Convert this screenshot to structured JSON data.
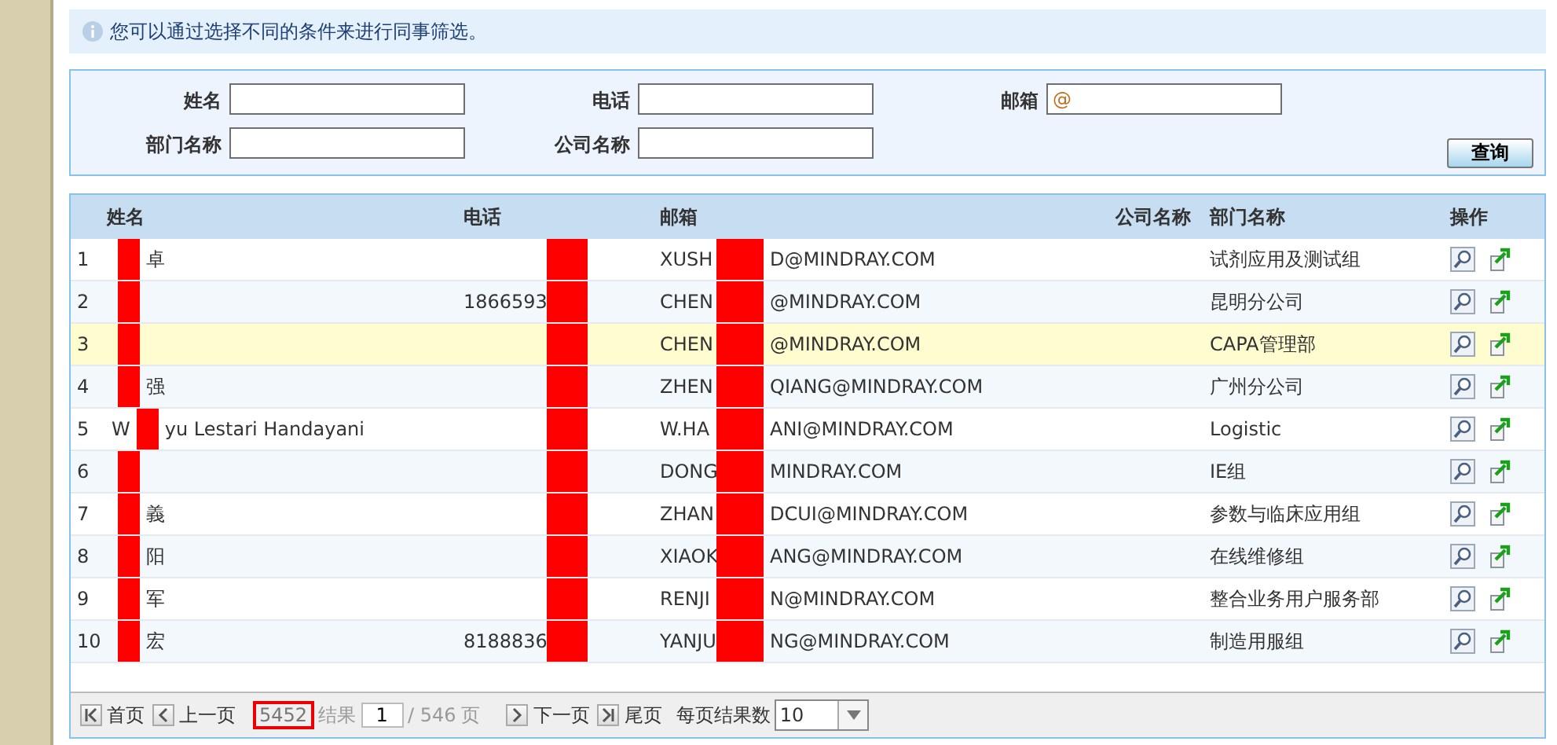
{
  "info": "您可以通过选择不同的条件来进行同事筛选。",
  "filters": [
    {
      "label": "姓名"
    },
    {
      "label": "电话"
    },
    {
      "label": "邮箱",
      "value": "@"
    },
    {
      "label": "部门名称"
    },
    {
      "label": "公司名称"
    }
  ],
  "search_button": "查询",
  "table": {
    "columns": [
      "姓名",
      "电话",
      "邮箱",
      "公司名称",
      "部门名称",
      "操作"
    ],
    "rows": [
      {
        "index": "1",
        "name_end": "卓",
        "email_start": "XUSH",
        "email_end": "D@MINDRAY.COM",
        "department": "试剂应用及测试组",
        "selected": false
      },
      {
        "index": "2",
        "phone_start": "1866593",
        "email_start": "CHEN",
        "email_end": "@MINDRAY.COM",
        "department": "昆明分公司",
        "selected": false
      },
      {
        "index": "3",
        "email_start": "CHEN",
        "email_end": "@MINDRAY.COM",
        "department": "CAPA管理部",
        "selected": true
      },
      {
        "index": "4",
        "name_end": "强",
        "email_start": "ZHEN",
        "email_end": "QIANG@MINDRAY.COM",
        "department": "广州分公司",
        "selected": false
      },
      {
        "index": "5",
        "name_start": "W",
        "name_end": "yu Lestari Handayani",
        "email_start": "W.HA",
        "email_end": "ANI@MINDRAY.COM",
        "department": "Logistic",
        "selected": false
      },
      {
        "index": "6",
        "email_start": "DONG",
        "email_end": "MINDRAY.COM",
        "department": "IE组",
        "selected": false
      },
      {
        "index": "7",
        "name_end": "義",
        "email_start": "ZHAN",
        "email_end": "DCUI@MINDRAY.COM",
        "department": "参数与临床应用组",
        "selected": false
      },
      {
        "index": "8",
        "name_end": "阳",
        "email_start": "XIAOK",
        "email_end": "ANG@MINDRAY.COM",
        "department": "在线维修组",
        "selected": false
      },
      {
        "index": "9",
        "name_end": "军",
        "email_start": "RENJI",
        "email_end": "N@MINDRAY.COM",
        "department": "整合业务用户服务部",
        "selected": false
      },
      {
        "index": "10",
        "name_end": "宏",
        "phone_start": "8188836",
        "email_start": "YANJU",
        "email_end": "NG@MINDRAY.COM",
        "department": "制造用服组",
        "selected": false
      }
    ]
  },
  "pager": {
    "first": "首页",
    "prev": "上一页",
    "total": "5452",
    "results_label": "结果",
    "page": "1",
    "of_pages": "/ 546",
    "page_unit": "页",
    "next": "下一页",
    "last": "尾页",
    "per_page_label": "每页结果数",
    "per_page": "10"
  }
}
